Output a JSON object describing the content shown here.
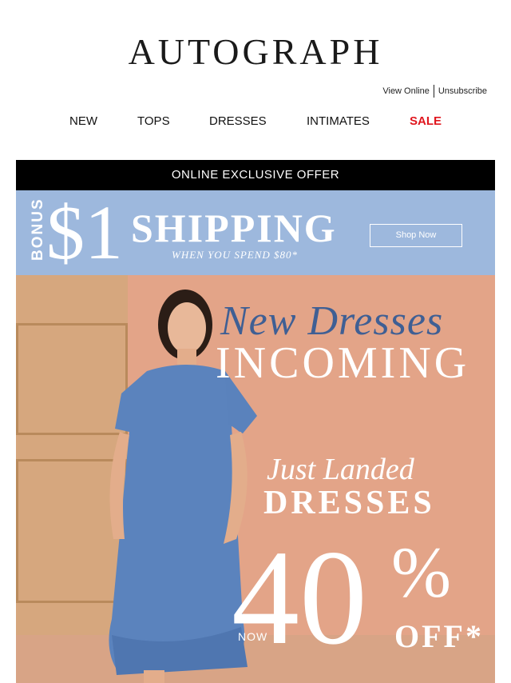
{
  "brand": {
    "logo": "AUTOGRAPH"
  },
  "utility": {
    "view_online": "View Online",
    "unsubscribe": "Unsubscribe"
  },
  "nav": {
    "items": [
      "NEW",
      "TOPS",
      "DRESSES",
      "INTIMATES",
      "SALE"
    ]
  },
  "offer_bar": {
    "text": "ONLINE EXCLUSIVE OFFER"
  },
  "shipping_banner": {
    "bonus": "BONUS",
    "price": "$1",
    "shipping": "SHIPPING",
    "condition": "WHEN YOU SPEND $80*",
    "button": "Shop Now"
  },
  "hero": {
    "script_title": "New Dresses",
    "title": "INCOMING",
    "subtitle_script": "Just Landed",
    "subtitle": "DRESSES",
    "now": "NOW",
    "discount": "40",
    "percent": "%",
    "off": "OFF*"
  },
  "colors": {
    "sale": "#e0161e",
    "shipping_bg": "#9db8dd",
    "hero_bg": "#e3a488",
    "script_blue": "#3f5f94"
  }
}
